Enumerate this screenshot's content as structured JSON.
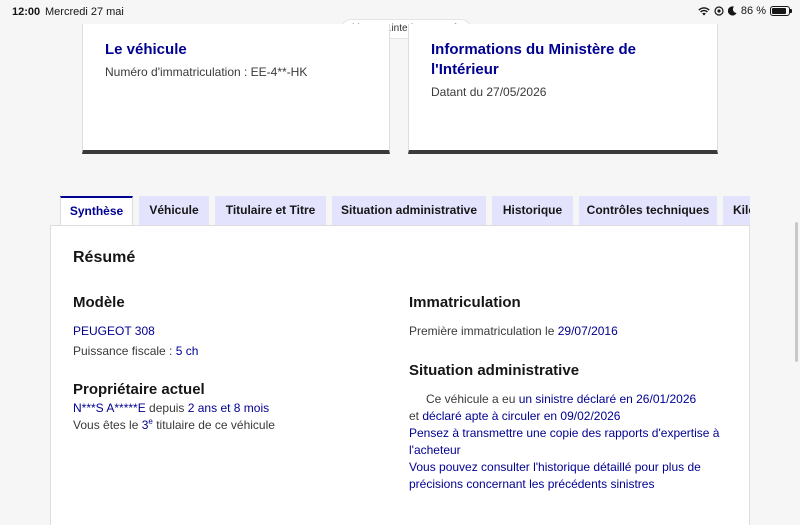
{
  "status_bar": {
    "time": "12:00",
    "date": "Mercredi 27 mai",
    "battery": "86 %",
    "battery_level": 0.86
  },
  "browser": {
    "url": "histovec.interieur.gouv.fr"
  },
  "cards": [
    {
      "title": "Le véhicule",
      "subtitle": "Numéro d'immatriculation : EE-4**-HK"
    },
    {
      "title": "Informations du Ministère de l'Intérieur",
      "subtitle": "Datant du 27/05/2026"
    }
  ],
  "tabs": [
    "Synthèse",
    "Véhicule",
    "Titulaire et Titre",
    "Situation administrative",
    "Historique",
    "Contrôles techniques",
    "Kilo"
  ],
  "resume": {
    "heading": "Résumé",
    "modele": {
      "heading": "Modèle",
      "name": "PEUGEOT 308",
      "puissance_label": "Puissance fiscale : ",
      "puissance_value": "5 ch"
    },
    "proprietaire": {
      "heading": "Propriétaire actuel",
      "name": "N***S A*****E",
      "depuis": " depuis ",
      "duree": "2 ans et 8 mois",
      "rang_prefix": "Vous êtes le ",
      "rang_num": "3",
      "rang_sup": "e",
      "rang_suffix": " titulaire de ce véhicule"
    },
    "immatriculation": {
      "heading": "Immatriculation",
      "label": "Première immatriculation le ",
      "date": "29/07/2016"
    },
    "situation": {
      "heading": "Situation administrative",
      "line1_prefix": "Ce véhicule a eu ",
      "line1_link": "un sinistre déclaré en 26/01/2026",
      "line2_prefix": "et ",
      "line2_link": "déclaré apte à circuler en 09/02/2026",
      "advice1_a": "Pensez à transmettre une copie des rapports d'expertise à",
      "advice1_b": "l'acheteur",
      "advice2_a": "Vous pouvez consulter l'historique détaillé pour plus de",
      "advice2_b": "précisions concernant les précédents sinistres"
    }
  },
  "colors": {
    "accent": "#000091",
    "tab_bg": "#e3e3fd",
    "text": "#161616"
  }
}
